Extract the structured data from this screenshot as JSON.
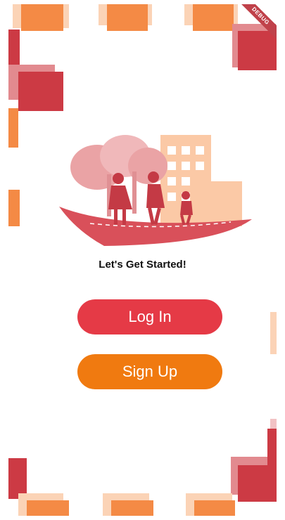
{
  "debug_banner": "DEBUG",
  "title": "Let's Get Started!",
  "buttons": {
    "login": "Log In",
    "signup": "Sign Up"
  },
  "colors": {
    "login": "#e53a46",
    "signup": "#f07a10",
    "accent_red": "#cc3a44",
    "accent_orange": "#f48a45"
  },
  "illustration": "people-walking-on-boat-with-trees-and-building"
}
